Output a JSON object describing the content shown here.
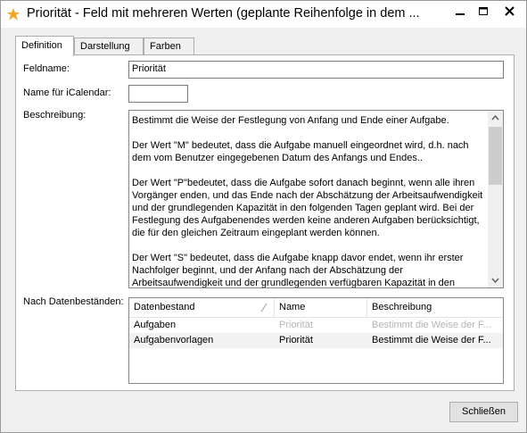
{
  "window": {
    "title": "Priorität - Feld mit mehreren Werten (geplante Reihenfolge in dem ..."
  },
  "tabs": [
    {
      "label": "Definition",
      "active": true
    },
    {
      "label": "Darstellung",
      "active": false
    },
    {
      "label": "Farben",
      "active": false
    }
  ],
  "form": {
    "feldname_label": "Feldname:",
    "feldname_value": "Priorität",
    "icalendar_label": "Name für iCalendar:",
    "icalendar_value": "",
    "beschreibung_label": "Beschreibung:",
    "beschreibung_paragraphs": [
      "Bestimmt die Weise der Festlegung von Anfang und Ende einer Aufgabe.",
      "Der Wert \"M\" bedeutet, dass die Aufgabe manuell eingeordnet wird, d.h. nach dem vom Benutzer eingegebenen Datum des Anfangs und Endes..",
      "Der Wert \"P\"bedeutet, dass die Aufgabe sofort danach beginnt, wenn alle ihren Vorgänger enden, und das Ende nach der Abschätzung der Arbeitsaufwendigkeit und der grundlegenden Kapazität in den folgenden Tagen geplant wird. Bei der Festlegung des Aufgabenendes werden keine anderen Aufgaben berücksichtigt, die für den gleichen Zeitraum eingeplant werden können.",
      "Der Wert \"S\" bedeutet, dass die Aufgabe knapp davor endet, wenn ihr erster Nachfolger beginnt, und der Anfang nach der Abschätzung  der Arbeitsaufwendigkeit und der grundlegenden verfügbaren Kapazität in den vorigen Tagen geplant wird. Bei einer Festlegung von Aufgabenanfang werden"
    ],
    "datenbestaende_label": "Nach Datenbeständen:"
  },
  "grid": {
    "columns": [
      "Datenbestand",
      "Name",
      "Beschreibung"
    ],
    "rows": [
      {
        "datenbestand": "Aufgaben",
        "name": "Priorität",
        "beschreibung": "Bestimmt die Weise der F...",
        "dimmed": true
      },
      {
        "datenbestand": "Aufgabenvorlagen",
        "name": "Priorität",
        "beschreibung": "Bestimmt die Weise der F...",
        "dimmed": false
      }
    ]
  },
  "buttons": {
    "close_label": "Schließen"
  },
  "colors": {
    "icon_orange": "#f5a623"
  }
}
